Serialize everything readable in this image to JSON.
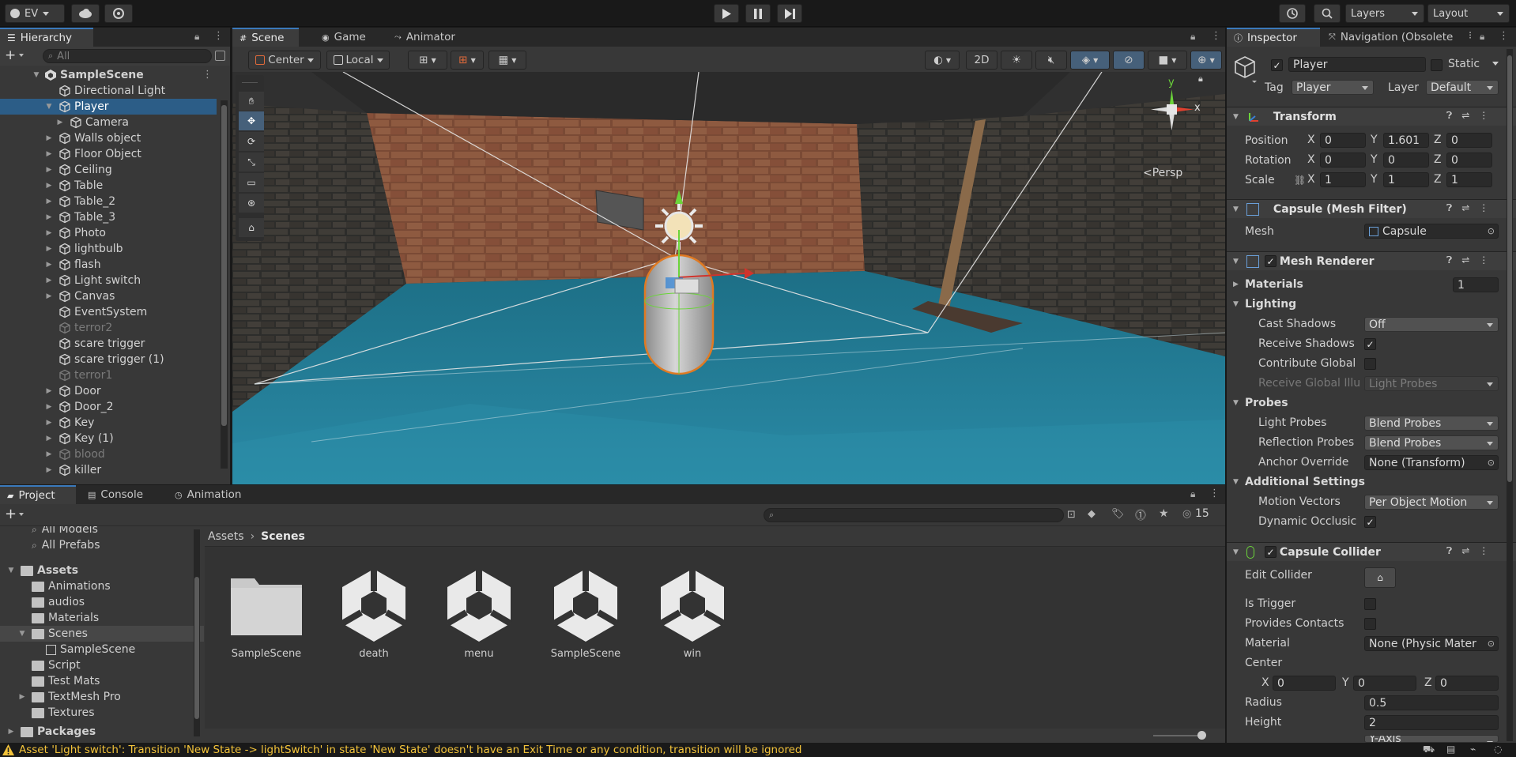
{
  "toolbar": {
    "account": "EV",
    "layers": "Layers",
    "layout": "Layout"
  },
  "hierarchy": {
    "tab": "Hierarchy",
    "search_placeholder": "All",
    "scene": "SampleScene",
    "items": [
      {
        "label": "Directional Light"
      },
      {
        "label": "Player"
      },
      {
        "label": "Camera"
      },
      {
        "label": "Walls object"
      },
      {
        "label": "Floor Object"
      },
      {
        "label": "Ceiling"
      },
      {
        "label": "Table"
      },
      {
        "label": "Table_2"
      },
      {
        "label": "Table_3"
      },
      {
        "label": "Photo"
      },
      {
        "label": "lightbulb"
      },
      {
        "label": "flash"
      },
      {
        "label": "Light switch"
      },
      {
        "label": "Canvas"
      },
      {
        "label": "EventSystem"
      },
      {
        "label": "terror2"
      },
      {
        "label": "scare trigger"
      },
      {
        "label": "scare trigger (1)"
      },
      {
        "label": "terror1"
      },
      {
        "label": "Door"
      },
      {
        "label": "Door_2"
      },
      {
        "label": "Key"
      },
      {
        "label": "Key (1)"
      },
      {
        "label": "blood"
      },
      {
        "label": "killer"
      }
    ]
  },
  "scene_tabs": [
    "Scene",
    "Game",
    "Animator"
  ],
  "scene_toolbar": {
    "pivot": "Center",
    "space": "Local",
    "mode_2d": "2D",
    "persp": "<Persp"
  },
  "gizmo": {
    "y": "y",
    "x": "x"
  },
  "inspector": {
    "tabs": [
      "Inspector",
      "Navigation (Obsolete"
    ],
    "object_name": "Player",
    "static_label": "Static",
    "tag_label": "Tag",
    "tag_value": "Player",
    "layer_label": "Layer",
    "layer_value": "Default",
    "transform": {
      "title": "Transform",
      "position_label": "Position",
      "rotation_label": "Rotation",
      "scale_label": "Scale",
      "position": {
        "x": "0",
        "y": "1.601",
        "z": "0"
      },
      "rotation": {
        "x": "0",
        "y": "0",
        "z": "0"
      },
      "scale": {
        "x": "1",
        "y": "1",
        "z": "1"
      },
      "axis_x": "X",
      "axis_y": "Y",
      "axis_z": "Z"
    },
    "mesh_filter": {
      "title": "Capsule (Mesh Filter)",
      "mesh_label": "Mesh",
      "mesh_value": "Capsule"
    },
    "mesh_renderer": {
      "title": "Mesh Renderer",
      "materials_label": "Materials",
      "materials_count": "1",
      "lighting": "Lighting",
      "cast_shadows_label": "Cast Shadows",
      "cast_shadows_value": "Off",
      "receive_shadows_label": "Receive Shadows",
      "contribute_gi_label": "Contribute Global",
      "receive_gi_label": "Receive Global Illu",
      "receive_gi_value": "Light Probes",
      "probes": "Probes",
      "light_probes_label": "Light Probes",
      "light_probes_value": "Blend Probes",
      "reflection_probes_label": "Reflection Probes",
      "reflection_probes_value": "Blend Probes",
      "anchor_override_label": "Anchor Override",
      "anchor_override_value": "None (Transform)",
      "additional_settings": "Additional Settings",
      "motion_vectors_label": "Motion Vectors",
      "motion_vectors_value": "Per Object Motion",
      "dynamic_occlusion_label": "Dynamic Occlusic"
    },
    "capsule_collider": {
      "title": "Capsule Collider",
      "edit_collider_label": "Edit Collider",
      "is_trigger_label": "Is Trigger",
      "provides_contacts_label": "Provides Contacts",
      "material_label": "Material",
      "material_value": "None (Physic Mater",
      "center_label": "Center",
      "center": {
        "x": "0",
        "y": "0",
        "z": "0"
      },
      "radius_label": "Radius",
      "radius_value": "0.5",
      "height_label": "Height",
      "height_value": "2",
      "direction_value": "Y-Axis"
    }
  },
  "bottom_tabs": [
    "Project",
    "Console",
    "Animation"
  ],
  "project": {
    "hidden_count": "15",
    "favorites": [
      "All Models",
      "All Prefabs"
    ],
    "tree": {
      "assets": "Assets",
      "folders": [
        "Animations",
        "audios",
        "Materials",
        "Scenes",
        "SampleScene",
        "Script",
        "Test Mats",
        "TextMesh Pro",
        "Textures"
      ],
      "packages": "Packages"
    },
    "breadcrumb": {
      "root": "Assets",
      "current": "Scenes"
    },
    "assets": [
      {
        "name": "SampleScene",
        "kind": "folder"
      },
      {
        "name": "death",
        "kind": "scene"
      },
      {
        "name": "menu",
        "kind": "scene"
      },
      {
        "name": "SampleScene",
        "kind": "scene"
      },
      {
        "name": "win",
        "kind": "scene"
      }
    ]
  },
  "status_bar": {
    "message": "Asset 'Light switch': Transition 'New State -> lightSwitch' in state 'New State' doesn't have an Exit Time or any condition, transition will be ignored",
    "accent": "#f3c33a"
  }
}
